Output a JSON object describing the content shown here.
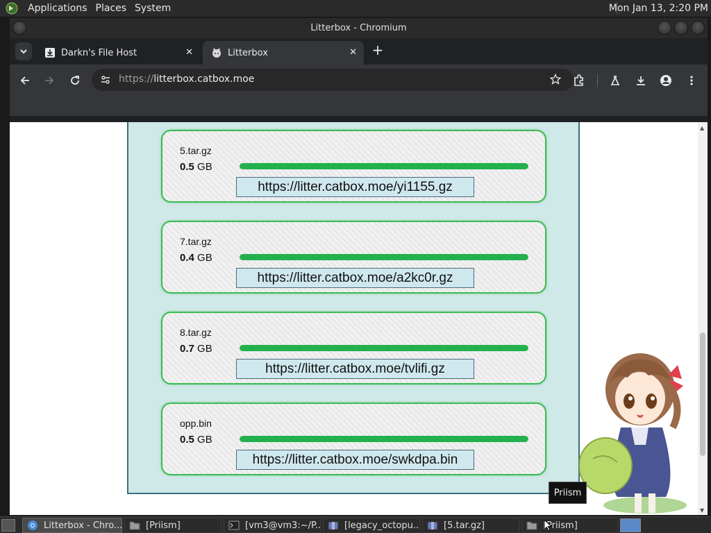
{
  "topbar": {
    "menus": [
      "Applications",
      "Places",
      "System"
    ],
    "clock": "Mon Jan 13,  2:20 PM"
  },
  "window": {
    "title": "Litterbox - Chromium"
  },
  "tabs": [
    {
      "label": "Darkn's File Host",
      "active": false
    },
    {
      "label": "Litterbox",
      "active": true
    }
  ],
  "omnibox": {
    "scheme": "https://",
    "host": "litterbox.catbox.moe"
  },
  "files": [
    {
      "name": "5.tar.gz",
      "size_value": "0.5",
      "size_unit": "GB",
      "progress": 100,
      "link": "https://litter.catbox.moe/yi1155.gz"
    },
    {
      "name": "7.tar.gz",
      "size_value": "0.4",
      "size_unit": "GB",
      "progress": 100,
      "link": "https://litter.catbox.moe/a2kc0r.gz"
    },
    {
      "name": "8.tar.gz",
      "size_value": "0.7",
      "size_unit": "GB",
      "progress": 100,
      "link": "https://litter.catbox.moe/tvlifi.gz"
    },
    {
      "name": "opp.bin",
      "size_value": "0.5",
      "size_unit": "GB",
      "progress": 100,
      "link": "https://litter.catbox.moe/swkdpa.bin"
    }
  ],
  "tooltip": "Priism",
  "taskbar": [
    {
      "label": "Litterbox - Chro...",
      "icon": "chromium-icon",
      "active": true
    },
    {
      "label": "[Priism]",
      "icon": "folder-icon",
      "active": false
    },
    {
      "label": "[vm3@vm3:~/P...",
      "icon": "terminal-icon",
      "active": false
    },
    {
      "label": "[legacy_octopu...",
      "icon": "archive-icon",
      "active": false
    },
    {
      "label": "[5.tar.gz]",
      "icon": "archive-icon",
      "active": false
    },
    {
      "label": "[Priism]",
      "icon": "folder-icon",
      "active": false
    }
  ],
  "colors": {
    "progress": "#22b14c",
    "card_border": "#3cba54",
    "panel_bg": "#cfe8e8"
  }
}
